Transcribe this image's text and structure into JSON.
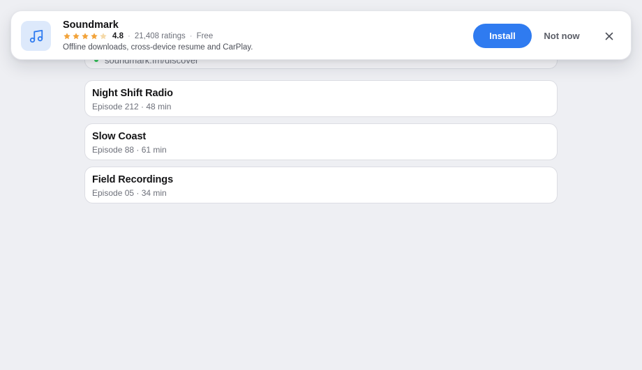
{
  "banner": {
    "app_name": "Soundmark",
    "app_icon": "music-note-icon",
    "rating": "4.8",
    "rating_stars": 4.5,
    "ratings_count": "21,408 ratings",
    "separator": "·",
    "price": "Free",
    "tagline": "Offline downloads, cross-device resume and CarPlay.",
    "install_label": "Install",
    "not_now_label": "Not now",
    "close_icon": "close-icon",
    "colors": {
      "accent": "#2f7bf0",
      "star": "#f2a33a",
      "star_empty": "#f5d9a8",
      "icon_bg": "#dde9fb"
    }
  },
  "page": {
    "url_text": "soundmark.fm/discover",
    "episodes": [
      {
        "title": "Night Shift Radio",
        "meta": "Episode 212 · 48 min"
      },
      {
        "title": "Slow Coast",
        "meta": "Episode 88 · 61 min"
      },
      {
        "title": "Field Recordings",
        "meta": "Episode 05 · 34 min"
      }
    ]
  }
}
